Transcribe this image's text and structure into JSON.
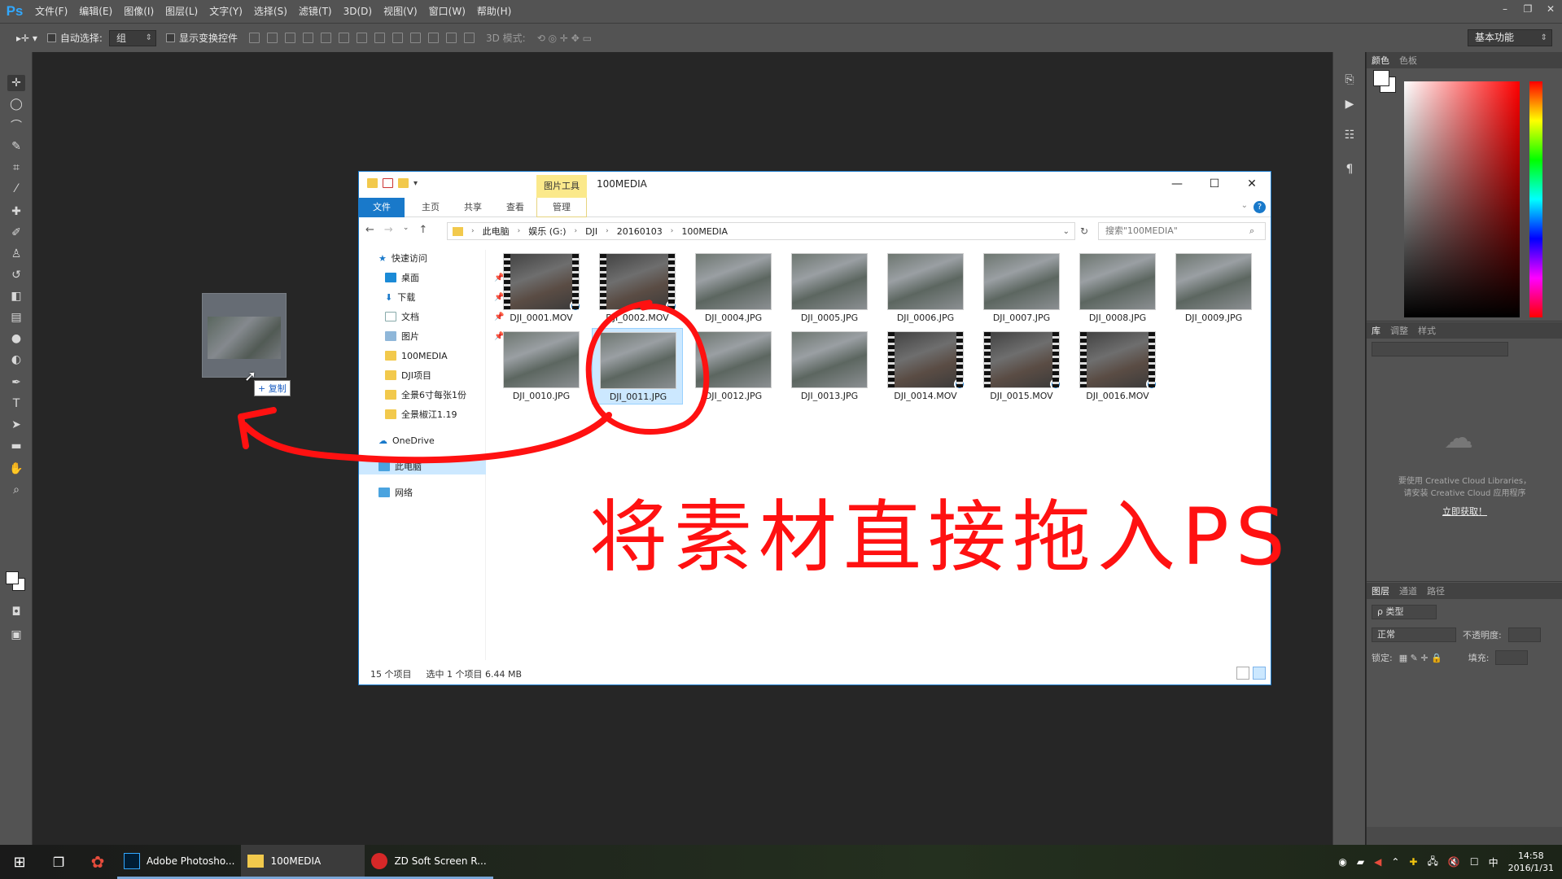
{
  "app": {
    "logo": "Ps",
    "menu": [
      "文件(F)",
      "编辑(E)",
      "图像(I)",
      "图层(L)",
      "文字(Y)",
      "选择(S)",
      "滤镜(T)",
      "3D(D)",
      "视图(V)",
      "窗口(W)",
      "帮助(H)"
    ],
    "window_controls": [
      "–",
      "❐",
      "✕"
    ]
  },
  "options": {
    "auto_select_label": "自动选择:",
    "auto_select_value": "组",
    "show_transform_label": "显示变换控件",
    "mode_3d_label": "3D 模式:",
    "workspace": "基本功能"
  },
  "panels": {
    "color_tabs": [
      "颜色",
      "色板"
    ],
    "library_tabs": [
      "库",
      "调整",
      "样式"
    ],
    "library_message_line1": "要使用 Creative Cloud Libraries，",
    "library_message_line2": "请安装 Creative Cloud 应用程序",
    "library_link": "立即获取！",
    "layers_tabs": [
      "图层",
      "通道",
      "路径"
    ],
    "layers_kind": "ρ 类型",
    "blend_mode": "正常",
    "opacity_label": "不透明度:",
    "lock_label": "锁定:",
    "fill_label": "填充:"
  },
  "drag": {
    "copy_label": "+ 复制"
  },
  "explorer": {
    "context_tab": "图片工具",
    "title": "100MEDIA",
    "ribbon_tabs": [
      "文件",
      "主页",
      "共享",
      "查看",
      "管理"
    ],
    "breadcrumb": [
      "此电脑",
      "娱乐 (G:)",
      "DJI",
      "20160103",
      "100MEDIA"
    ],
    "search_placeholder": "搜索\"100MEDIA\"",
    "nav": {
      "quick_access": "快速访问",
      "desktop": "桌面",
      "downloads": "下载",
      "documents": "文档",
      "pictures": "图片",
      "folder1": "100MEDIA",
      "folder2": "DJI项目",
      "folder3": "全景6寸每张1份",
      "folder4": "全景椒江1.19",
      "onedrive": "OneDrive",
      "this_pc": "此电脑",
      "network": "网络"
    },
    "files": [
      {
        "name": "DJI_0001.MOV",
        "video": true
      },
      {
        "name": "DJI_0002.MOV",
        "video": true
      },
      {
        "name": "DJI_0004.JPG",
        "video": false
      },
      {
        "name": "DJI_0005.JPG",
        "video": false
      },
      {
        "name": "DJI_0006.JPG",
        "video": false
      },
      {
        "name": "DJI_0007.JPG",
        "video": false
      },
      {
        "name": "DJI_0008.JPG",
        "video": false
      },
      {
        "name": "DJI_0009.JPG",
        "video": false
      },
      {
        "name": "DJI_0010.JPG",
        "video": false
      },
      {
        "name": "DJI_0011.JPG",
        "video": false,
        "selected": true
      },
      {
        "name": "DJI_0012.JPG",
        "video": false
      },
      {
        "name": "DJI_0013.JPG",
        "video": false
      },
      {
        "name": "DJI_0014.MOV",
        "video": true
      },
      {
        "name": "DJI_0015.MOV",
        "video": true
      },
      {
        "name": "DJI_0016.MOV",
        "video": true
      }
    ],
    "status_count": "15 个项目",
    "status_selected": "选中 1 个项目  6.44 MB"
  },
  "annotation": {
    "text": "将素材直接拖入PS",
    "color": "#ff1111"
  },
  "taskbar": {
    "apps": [
      "Adobe Photosho...",
      "100MEDIA",
      "ZD Soft Screen R..."
    ],
    "ime": "中",
    "time": "14:58",
    "date": "2016/1/31"
  }
}
